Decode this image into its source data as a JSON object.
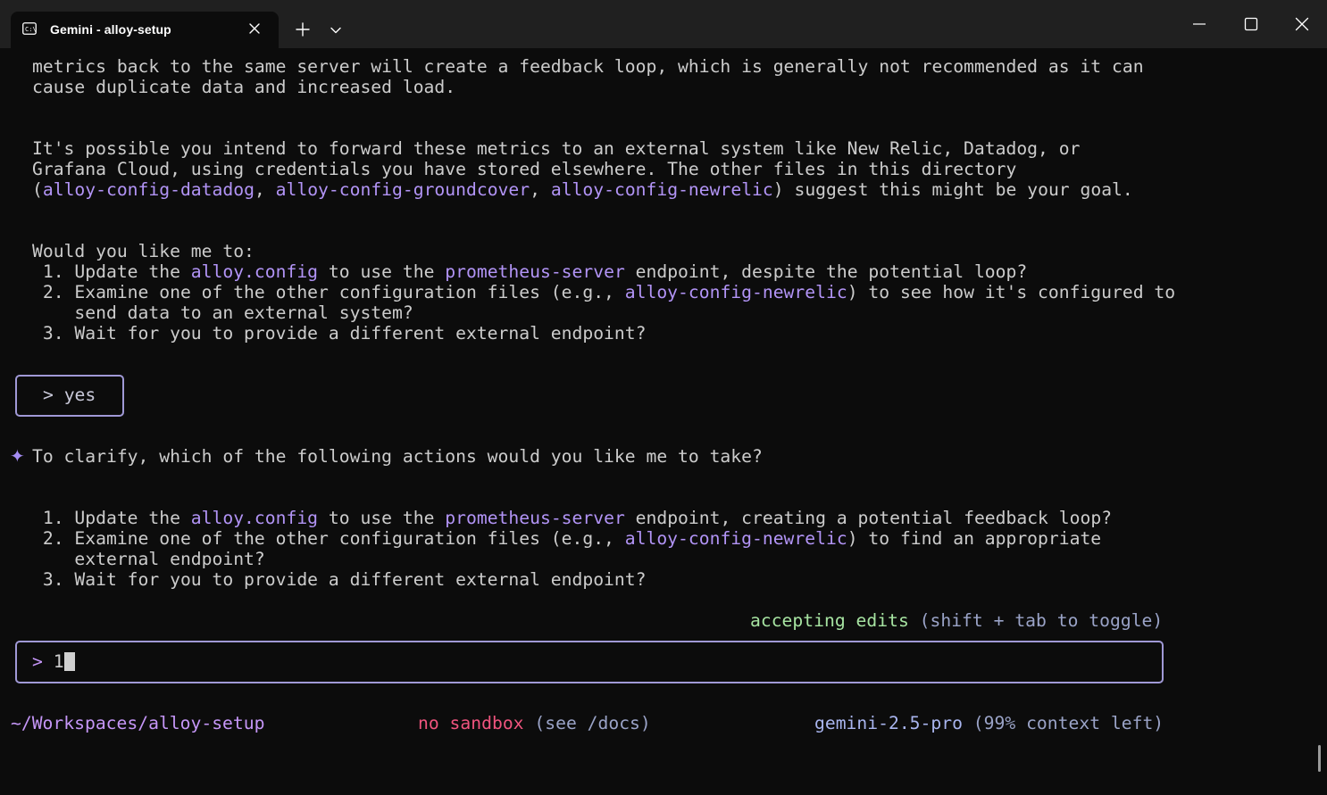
{
  "tab": {
    "title": "Gemini - alloy-setup"
  },
  "icons": {
    "tab_icon": "terminal-icon",
    "close": "close-icon",
    "new_tab": "plus-icon",
    "dropdown": "chevron-down-icon",
    "minimize": "minimize-icon",
    "maximize": "maximize-icon",
    "window_close": "close-icon",
    "spark": "sparkle-icon"
  },
  "colors": {
    "highlight": "#b294f6",
    "accepting": "#a6e3a1",
    "sandbox": "#f0547e",
    "box_border": "#a099d6"
  },
  "conversation": {
    "para1": {
      "l1": "metrics back to the same server will create a feedback loop, which is generally not recommended as it can",
      "l2": "cause duplicate data and increased load."
    },
    "para2": {
      "l1": "It's possible you intend to forward these metrics to an external system like New Relic, Datadog, or",
      "l2": "Grafana Cloud, using credentials you have stored elsewhere. The other files in this directory",
      "l3_open": "(",
      "l3_f1": "alloy-config-datadog",
      "l3_sep1": ", ",
      "l3_f2": "alloy-config-groundcover",
      "l3_sep2": ", ",
      "l3_f3": "alloy-config-newrelic",
      "l3_rest": ") suggest this might be your goal."
    },
    "question1": {
      "intro": "Would you like me to:",
      "o1_a": " 1. Update the ",
      "o1_b": "alloy.config",
      "o1_c": " to use the ",
      "o1_d": "prometheus-server",
      "o1_e": " endpoint, despite the potential loop?",
      "o2_a": " 2. Examine one of the other configuration files (e.g., ",
      "o2_b": "alloy-config-newrelic",
      "o2_c": ") to see how it's configured to",
      "o2_d": "    send data to an external system?",
      "o3": " 3. Wait for you to provide a different external endpoint?"
    },
    "user_reply": "> yes",
    "question2": {
      "intro": "To clarify, which of the following actions would you like me to take?",
      "o1_a": " 1. Update the ",
      "o1_b": "alloy.config",
      "o1_c": " to use the ",
      "o1_d": "prometheus-server",
      "o1_e": " endpoint, creating a potential feedback loop?",
      "o2_a": " 2. Examine one of the other configuration files (e.g., ",
      "o2_b": "alloy-config-newrelic",
      "o2_c": ") to find an appropriate",
      "o2_d": "    external endpoint?",
      "o3": " 3. Wait for you to provide a different external endpoint?"
    }
  },
  "mode": {
    "label": "accepting edits",
    "hint": " (shift + tab to toggle)"
  },
  "input": {
    "prompt": "> ",
    "value": "1"
  },
  "footer": {
    "path": "~/Workspaces/alloy-setup",
    "sandbox": "no sandbox",
    "sandbox_hint": " (see /docs)",
    "model": "gemini-2.5-pro",
    "context": " (99% context left)"
  }
}
